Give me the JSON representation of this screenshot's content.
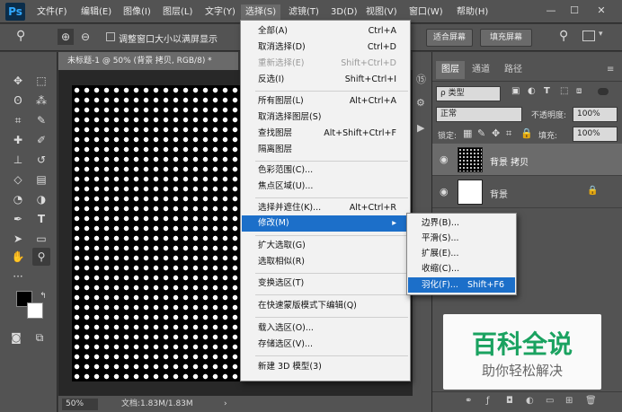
{
  "menubar": {
    "logo": "Ps",
    "items": [
      "文件(F)",
      "编辑(E)",
      "图像(I)",
      "图层(L)",
      "文字(Y)",
      "选择(S)",
      "滤镜(T)",
      "3D(D)",
      "视图(V)",
      "窗口(W)",
      "帮助(H)"
    ],
    "active_index": 5,
    "window_controls": [
      "—",
      "☐",
      "✕"
    ]
  },
  "options_bar": {
    "resize_checkbox_label": "调整窗口大小以满屏显示",
    "fit_screen_label": "适合屏幕",
    "fill_screen_label": "填充屏幕"
  },
  "document": {
    "tab_title": "未标题-1 @ 50% (背景 拷贝, RGB/8) *",
    "zoom": "50%",
    "doc_info": "文档:1.83M/1.83M"
  },
  "select_menu": {
    "items": [
      {
        "label": "全部(A)",
        "shortcut": "Ctrl+A"
      },
      {
        "label": "取消选择(D)",
        "shortcut": "Ctrl+D"
      },
      {
        "label": "重新选择(E)",
        "shortcut": "Shift+Ctrl+D"
      },
      {
        "label": "反选(I)",
        "shortcut": "Shift+Ctrl+I"
      },
      {
        "label": "所有图层(L)",
        "shortcut": "Alt+Ctrl+A"
      },
      {
        "label": "取消选择图层(S)",
        "shortcut": ""
      },
      {
        "label": "查找图层",
        "shortcut": "Alt+Shift+Ctrl+F"
      },
      {
        "label": "隔离图层",
        "shortcut": ""
      },
      {
        "label": "色彩范围(C)...",
        "shortcut": ""
      },
      {
        "label": "焦点区域(U)...",
        "shortcut": ""
      },
      {
        "label": "选择并遮住(K)...",
        "shortcut": "Alt+Ctrl+R"
      },
      {
        "label": "修改(M)",
        "shortcut": "▸"
      },
      {
        "label": "扩大选取(G)",
        "shortcut": ""
      },
      {
        "label": "选取相似(R)",
        "shortcut": ""
      },
      {
        "label": "变换选区(T)",
        "shortcut": ""
      },
      {
        "label": "在快速蒙版模式下编辑(Q)",
        "shortcut": ""
      },
      {
        "label": "载入选区(O)...",
        "shortcut": ""
      },
      {
        "label": "存储选区(V)...",
        "shortcut": ""
      },
      {
        "label": "新建 3D 模型(3)",
        "shortcut": ""
      }
    ]
  },
  "modify_submenu": {
    "items": [
      {
        "label": "边界(B)...",
        "shortcut": ""
      },
      {
        "label": "平滑(S)...",
        "shortcut": ""
      },
      {
        "label": "扩展(E)...",
        "shortcut": ""
      },
      {
        "label": "收缩(C)...",
        "shortcut": ""
      },
      {
        "label": "羽化(F)...",
        "shortcut": "Shift+F6"
      }
    ]
  },
  "layers_panel": {
    "tabs": [
      "图层",
      "通道",
      "路径"
    ],
    "filter_kind": "ρ 类型",
    "blend_mode": "正常",
    "opacity_label": "不透明度:",
    "opacity_value": "100%",
    "lock_label": "锁定:",
    "fill_label": "填充:",
    "fill_value": "100%",
    "layers": [
      {
        "name": "背景 拷贝"
      },
      {
        "name": "背景"
      }
    ]
  },
  "watermark": {
    "title": "百科全说",
    "subtitle": "助你轻松解决"
  },
  "colors": {
    "highlight": "#1c6fc9",
    "panel": "#535353"
  }
}
